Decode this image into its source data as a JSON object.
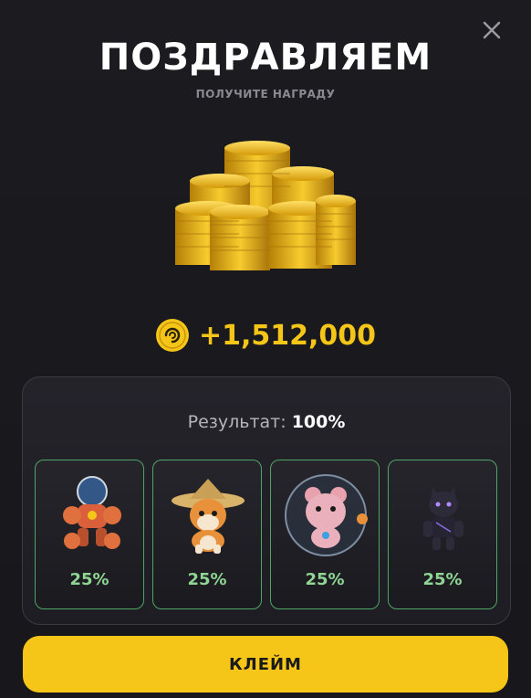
{
  "header": {
    "title": "ПОЗДРАВЛЯЕМ",
    "subtitle": "ПОЛУЧИТЕ НАГРАДУ"
  },
  "reward": {
    "amount": "+1,512,000",
    "icon": "coin-icon"
  },
  "result": {
    "label": "Результат:",
    "value": "100%"
  },
  "cards": [
    {
      "name": "robot-character-card",
      "percent": "25%"
    },
    {
      "name": "shiba-character-card",
      "percent": "25%"
    },
    {
      "name": "hamster-character-card",
      "percent": "25%"
    },
    {
      "name": "panther-character-card",
      "percent": "25%"
    }
  ],
  "actions": {
    "claim_label": "КЛЕЙМ"
  },
  "colors": {
    "accent": "#f5c518",
    "card_border": "#4fa567",
    "percent_text": "#8fd694",
    "background": "#1c1b1f"
  }
}
